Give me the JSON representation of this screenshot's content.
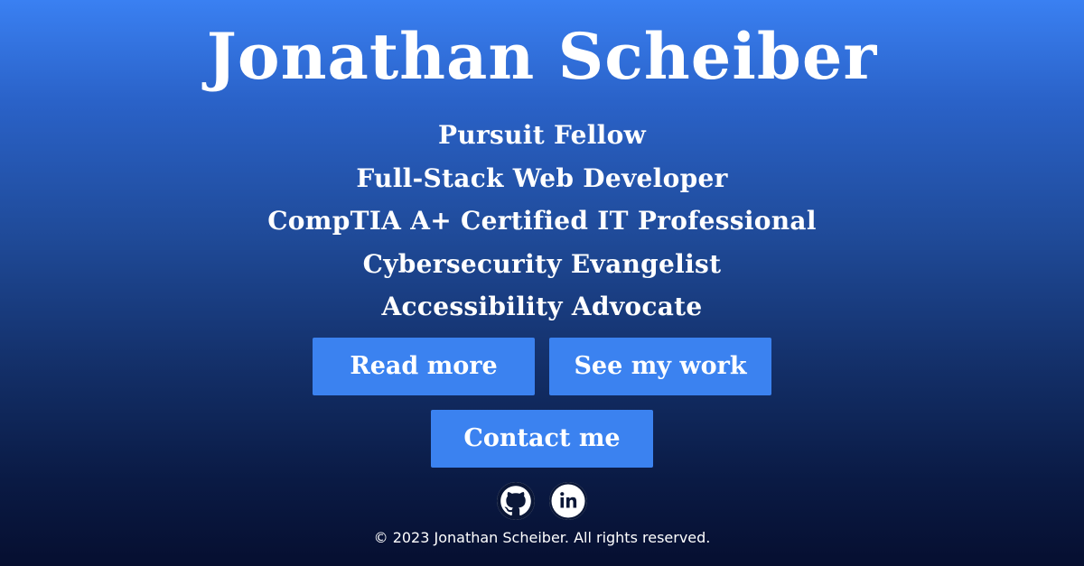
{
  "hero": {
    "name": "Jonathan Scheiber",
    "titles": [
      "Pursuit Fellow",
      "Full-Stack Web Developer",
      "CompTIA A+ Certified IT Professional",
      "Cybersecurity Evangelist",
      "Accessibility Advocate"
    ]
  },
  "buttons": {
    "read_more": "Read more",
    "see_work": "See my work",
    "contact": "Contact me"
  },
  "socials": [
    {
      "icon": "github-icon"
    },
    {
      "icon": "linkedin-icon"
    }
  ],
  "footer": {
    "copyright": "© 2023 Jonathan Scheiber. All rights reserved."
  },
  "colors": {
    "button_bg": "#3b82f0",
    "gradient_top": "#3a80f2",
    "gradient_bottom": "#060f30",
    "text": "#ffffff"
  }
}
